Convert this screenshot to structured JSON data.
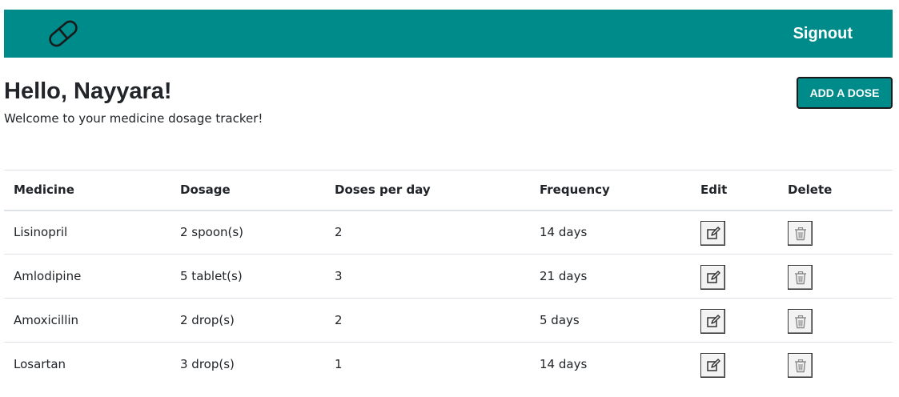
{
  "navbar": {
    "logo_icon": "pill-icon",
    "signout_label": "Signout",
    "background": "#008b8b"
  },
  "header": {
    "greeting": "Hello, Nayyara!",
    "subtitle": "Welcome to your medicine dosage tracker!",
    "add_button_label": "ADD A DOSE"
  },
  "table": {
    "columns": [
      "Medicine",
      "Dosage",
      "Doses per day",
      "Frequency",
      "Edit",
      "Delete"
    ],
    "rows": [
      {
        "medicine": "Lisinopril",
        "dosage": "2 spoon(s)",
        "doses_per_day": "2",
        "frequency": "14 days"
      },
      {
        "medicine": "Amlodipine",
        "dosage": "5 tablet(s)",
        "doses_per_day": "3",
        "frequency": "21 days"
      },
      {
        "medicine": "Amoxicillin",
        "dosage": "2 drop(s)",
        "doses_per_day": "2",
        "frequency": "5 days"
      },
      {
        "medicine": "Losartan",
        "dosage": "3 drop(s)",
        "doses_per_day": "1",
        "frequency": "14 days"
      }
    ],
    "edit_icon": "edit-icon",
    "delete_icon": "trash-icon"
  }
}
